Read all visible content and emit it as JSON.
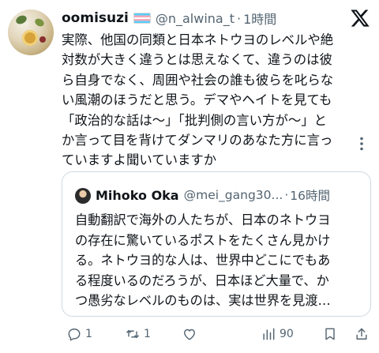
{
  "tweet": {
    "display_name": "oomisuzi",
    "handle": "@n_alwina_t",
    "separator": "·",
    "time": "1時間",
    "text": "実際、他国の同類と日本ネトウヨのレベルや絶\n対数が大きく違うとは思えなくて、違うのは彼\nら自身でなく、周囲や社会の誰も彼らを叱らな\nい風潮のほうだと思う。デマやヘイトを見ても\n「政治的な話は〜」「批判側の言い方が〜」と\nか言って目を背けてダンマリのあなた方に言っ\nていますよ聞いていますか"
  },
  "quote": {
    "display_name": "Mihoko Oka",
    "handle": "@mei_gang30...",
    "separator": "·",
    "time": "16時間",
    "text": "自動翻訳で海外の人たちが、日本のネトウヨ\nの存在に驚いているポストをたくさん見かけ\nる。ネトウヨ的な人は、世界中どこにでもあ\nる程度いるのだろうが、日本ほど大量で、か\nつ愚劣なレベルのものは、実は世界を見渡…"
  },
  "actions": {
    "reply_count": "1",
    "retweet_count": "1",
    "like_count": "",
    "views_count": "90"
  },
  "icons": {
    "logo": "x-logo-icon",
    "more": "more-vertical-icon",
    "reply": "reply-icon",
    "retweet": "retweet-icon",
    "like": "heart-icon",
    "views": "views-icon",
    "bookmark": "bookmark-icon",
    "share": "share-icon"
  },
  "colors": {
    "text": "#0f1419",
    "secondary": "#536471",
    "border": "#cfd9de"
  }
}
